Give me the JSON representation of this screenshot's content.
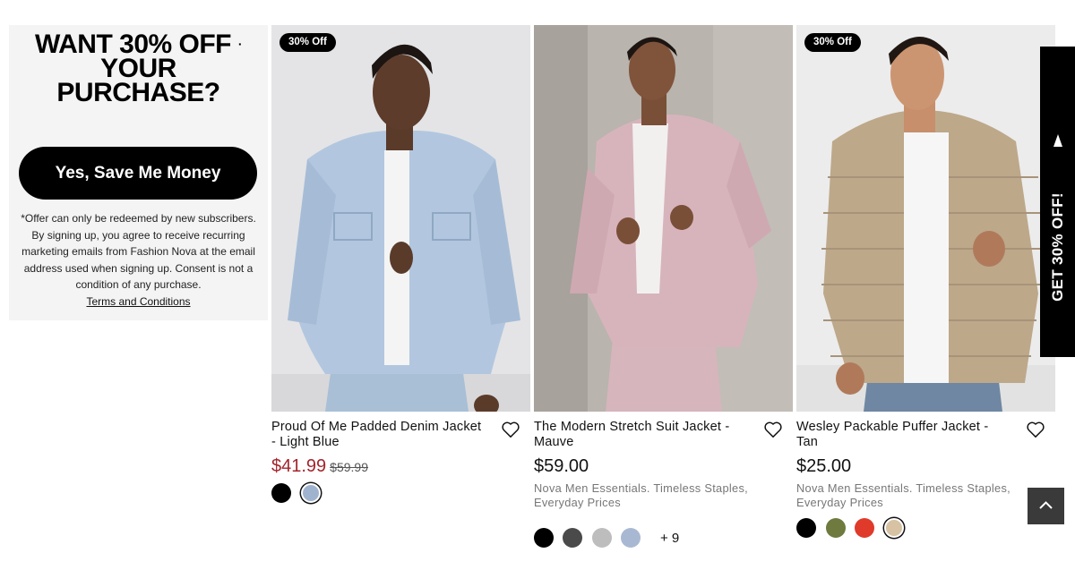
{
  "promo": {
    "title_line1": "WANT 30% OFF",
    "title_dot": "·",
    "title_line2": "YOUR",
    "title_line3": "PURCHASE?",
    "button_label": "Yes, Save Me Money",
    "fine_print": "*Offer can only be redeemed by new subscribers. By signing up, you agree to receive recurring marketing emails from Fashion Nova at the email address used when signing up. Consent is not a condition of any purchase.",
    "terms_label": "Terms and Conditions"
  },
  "products": [
    {
      "badge": "30% Off",
      "name": "Proud Of Me Padded Denim Jacket - Light Blue",
      "sale_price": "$41.99",
      "original_price": "$59.99",
      "swatch_colors": [
        "#000000",
        "#9fb3cf"
      ]
    },
    {
      "name": "The Modern Stretch Suit Jacket - Mauve",
      "price": "$59.00",
      "tagline": "Nova Men Essentials. Timeless Staples, Everyday Prices",
      "swatch_colors": [
        "#000000",
        "#4a4a4a",
        "#bdbdbd",
        "#a9b8d2"
      ],
      "more_colors": "+ 9"
    },
    {
      "badge": "30% Off",
      "name": "Wesley Packable Puffer Jacket - Tan",
      "price": "$25.00",
      "tagline": "Nova Men Essentials. Timeless Staples, Everyday Prices",
      "swatch_colors": [
        "#000000",
        "#6e7a3e",
        "#e03a2a",
        "#d8c2a4"
      ]
    }
  ],
  "side_tab": {
    "label": "GET 30% OFF!",
    "icon": "caret-up-icon"
  },
  "back_to_top": {
    "icon": "chevron-up-icon"
  },
  "colors": {
    "sale_red": "#a3242b",
    "black": "#000000",
    "panel_gray": "#f4f4f4"
  }
}
